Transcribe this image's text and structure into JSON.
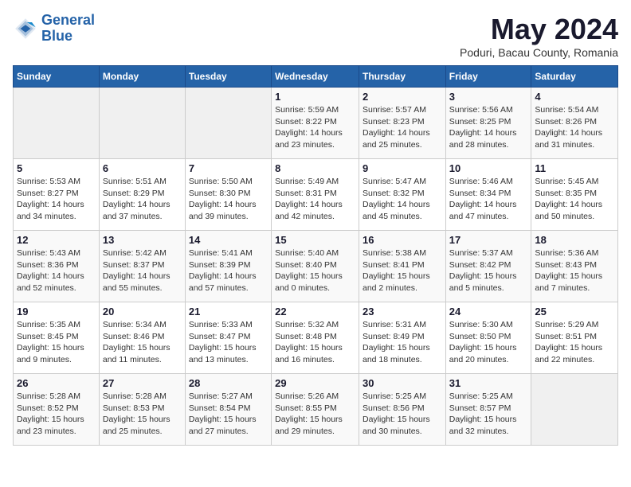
{
  "header": {
    "logo_line1": "General",
    "logo_line2": "Blue",
    "month_title": "May 2024",
    "location": "Poduri, Bacau County, Romania"
  },
  "weekdays": [
    "Sunday",
    "Monday",
    "Tuesday",
    "Wednesday",
    "Thursday",
    "Friday",
    "Saturday"
  ],
  "weeks": [
    [
      {
        "day": "",
        "info": ""
      },
      {
        "day": "",
        "info": ""
      },
      {
        "day": "",
        "info": ""
      },
      {
        "day": "1",
        "info": "Sunrise: 5:59 AM\nSunset: 8:22 PM\nDaylight: 14 hours\nand 23 minutes."
      },
      {
        "day": "2",
        "info": "Sunrise: 5:57 AM\nSunset: 8:23 PM\nDaylight: 14 hours\nand 25 minutes."
      },
      {
        "day": "3",
        "info": "Sunrise: 5:56 AM\nSunset: 8:25 PM\nDaylight: 14 hours\nand 28 minutes."
      },
      {
        "day": "4",
        "info": "Sunrise: 5:54 AM\nSunset: 8:26 PM\nDaylight: 14 hours\nand 31 minutes."
      }
    ],
    [
      {
        "day": "5",
        "info": "Sunrise: 5:53 AM\nSunset: 8:27 PM\nDaylight: 14 hours\nand 34 minutes."
      },
      {
        "day": "6",
        "info": "Sunrise: 5:51 AM\nSunset: 8:29 PM\nDaylight: 14 hours\nand 37 minutes."
      },
      {
        "day": "7",
        "info": "Sunrise: 5:50 AM\nSunset: 8:30 PM\nDaylight: 14 hours\nand 39 minutes."
      },
      {
        "day": "8",
        "info": "Sunrise: 5:49 AM\nSunset: 8:31 PM\nDaylight: 14 hours\nand 42 minutes."
      },
      {
        "day": "9",
        "info": "Sunrise: 5:47 AM\nSunset: 8:32 PM\nDaylight: 14 hours\nand 45 minutes."
      },
      {
        "day": "10",
        "info": "Sunrise: 5:46 AM\nSunset: 8:34 PM\nDaylight: 14 hours\nand 47 minutes."
      },
      {
        "day": "11",
        "info": "Sunrise: 5:45 AM\nSunset: 8:35 PM\nDaylight: 14 hours\nand 50 minutes."
      }
    ],
    [
      {
        "day": "12",
        "info": "Sunrise: 5:43 AM\nSunset: 8:36 PM\nDaylight: 14 hours\nand 52 minutes."
      },
      {
        "day": "13",
        "info": "Sunrise: 5:42 AM\nSunset: 8:37 PM\nDaylight: 14 hours\nand 55 minutes."
      },
      {
        "day": "14",
        "info": "Sunrise: 5:41 AM\nSunset: 8:39 PM\nDaylight: 14 hours\nand 57 minutes."
      },
      {
        "day": "15",
        "info": "Sunrise: 5:40 AM\nSunset: 8:40 PM\nDaylight: 15 hours\nand 0 minutes."
      },
      {
        "day": "16",
        "info": "Sunrise: 5:38 AM\nSunset: 8:41 PM\nDaylight: 15 hours\nand 2 minutes."
      },
      {
        "day": "17",
        "info": "Sunrise: 5:37 AM\nSunset: 8:42 PM\nDaylight: 15 hours\nand 5 minutes."
      },
      {
        "day": "18",
        "info": "Sunrise: 5:36 AM\nSunset: 8:43 PM\nDaylight: 15 hours\nand 7 minutes."
      }
    ],
    [
      {
        "day": "19",
        "info": "Sunrise: 5:35 AM\nSunset: 8:45 PM\nDaylight: 15 hours\nand 9 minutes."
      },
      {
        "day": "20",
        "info": "Sunrise: 5:34 AM\nSunset: 8:46 PM\nDaylight: 15 hours\nand 11 minutes."
      },
      {
        "day": "21",
        "info": "Sunrise: 5:33 AM\nSunset: 8:47 PM\nDaylight: 15 hours\nand 13 minutes."
      },
      {
        "day": "22",
        "info": "Sunrise: 5:32 AM\nSunset: 8:48 PM\nDaylight: 15 hours\nand 16 minutes."
      },
      {
        "day": "23",
        "info": "Sunrise: 5:31 AM\nSunset: 8:49 PM\nDaylight: 15 hours\nand 18 minutes."
      },
      {
        "day": "24",
        "info": "Sunrise: 5:30 AM\nSunset: 8:50 PM\nDaylight: 15 hours\nand 20 minutes."
      },
      {
        "day": "25",
        "info": "Sunrise: 5:29 AM\nSunset: 8:51 PM\nDaylight: 15 hours\nand 22 minutes."
      }
    ],
    [
      {
        "day": "26",
        "info": "Sunrise: 5:28 AM\nSunset: 8:52 PM\nDaylight: 15 hours\nand 23 minutes."
      },
      {
        "day": "27",
        "info": "Sunrise: 5:28 AM\nSunset: 8:53 PM\nDaylight: 15 hours\nand 25 minutes."
      },
      {
        "day": "28",
        "info": "Sunrise: 5:27 AM\nSunset: 8:54 PM\nDaylight: 15 hours\nand 27 minutes."
      },
      {
        "day": "29",
        "info": "Sunrise: 5:26 AM\nSunset: 8:55 PM\nDaylight: 15 hours\nand 29 minutes."
      },
      {
        "day": "30",
        "info": "Sunrise: 5:25 AM\nSunset: 8:56 PM\nDaylight: 15 hours\nand 30 minutes."
      },
      {
        "day": "31",
        "info": "Sunrise: 5:25 AM\nSunset: 8:57 PM\nDaylight: 15 hours\nand 32 minutes."
      },
      {
        "day": "",
        "info": ""
      }
    ]
  ]
}
